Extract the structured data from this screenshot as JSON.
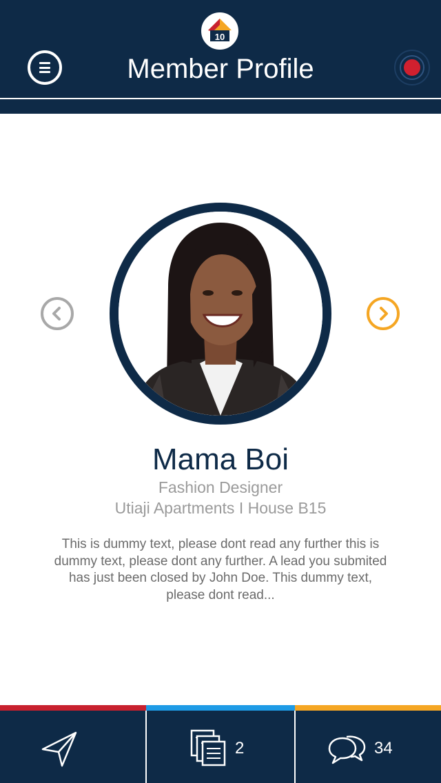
{
  "header": {
    "title": "Member Profile",
    "logo_badge": "10",
    "menu_icon": "hamburger-icon",
    "record_icon": "record-icon"
  },
  "profile": {
    "name": "Mama Boi",
    "role": "Fashion Designer",
    "address": "Utiaji Apartments I House B15",
    "bio": "This is dummy text, please dont read  any further this is dummy text, please  dont any further. A lead you submited  has just been closed by John Doe. This dummy text, please dont read..."
  },
  "carousel": {
    "prev_icon": "chevron-left-icon",
    "next_icon": "chevron-right-icon"
  },
  "bottom_bar": {
    "tabs": [
      {
        "icon": "send-icon",
        "count": ""
      },
      {
        "icon": "documents-icon",
        "count": "2"
      },
      {
        "icon": "chat-bubbles-icon",
        "count": "34"
      }
    ]
  },
  "colors": {
    "navy": "#0e2a47",
    "red": "#c8202e",
    "blue": "#1e9be6",
    "orange": "#f5a623",
    "grey": "#a8a8a8"
  }
}
